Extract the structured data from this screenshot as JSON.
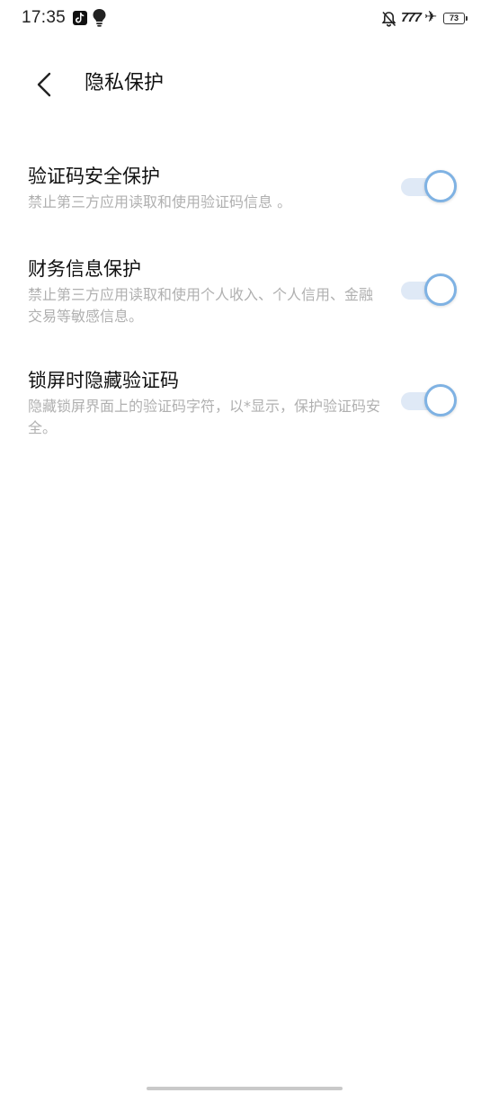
{
  "status_bar": {
    "time": "17:35",
    "signal_label": "777",
    "battery_level": "73",
    "icons": [
      "tiktok-icon",
      "bulb-icon",
      "bell-off-icon",
      "airplane-icon",
      "battery-icon"
    ]
  },
  "header": {
    "back_icon": "chevron-left-icon",
    "title": "隐私保护"
  },
  "settings": [
    {
      "title": "验证码安全保护",
      "description": "禁止第三方应用读取和使用验证码信息 。",
      "enabled": true
    },
    {
      "title": "财务信息保护",
      "description": "禁止第三方应用读取和使用个人收入、个人信用、金融交易等敏感信息。",
      "enabled": true
    },
    {
      "title": "锁屏时隐藏验证码",
      "description": "隐藏锁屏界面上的验证码字符，以*显示，保护验证码安全。",
      "enabled": true
    }
  ],
  "colors": {
    "toggle_track": "#dfe9f6",
    "toggle_knob_border": "#7fb2e3",
    "description_text": "#b0b0b0"
  }
}
